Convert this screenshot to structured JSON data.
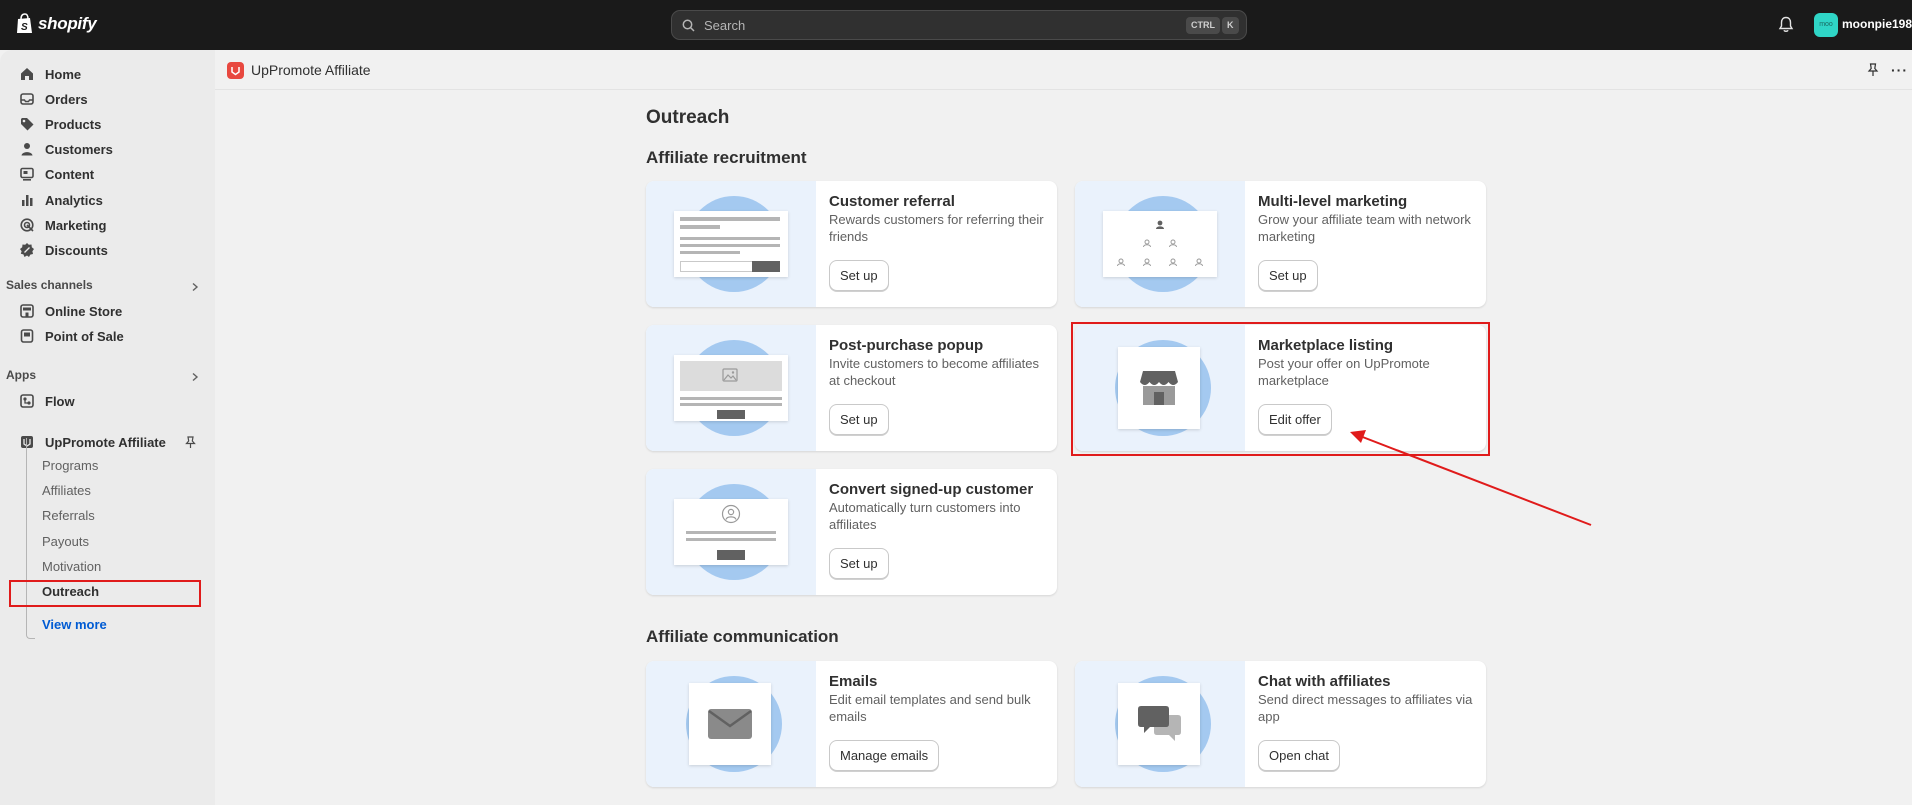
{
  "topbar": {
    "brand": "shopify",
    "search_placeholder": "Search",
    "kbd_ctrl": "CTRL",
    "kbd_k": "K",
    "avatar_initials": "moo",
    "username": "moonpie198"
  },
  "sidebar": {
    "main_items": [
      {
        "label": "Home",
        "icon": "home-icon"
      },
      {
        "label": "Orders",
        "icon": "inbox-icon"
      },
      {
        "label": "Products",
        "icon": "tag-icon"
      },
      {
        "label": "Customers",
        "icon": "person-icon"
      },
      {
        "label": "Content",
        "icon": "content-icon"
      },
      {
        "label": "Analytics",
        "icon": "bar-chart-icon"
      },
      {
        "label": "Marketing",
        "icon": "target-icon"
      },
      {
        "label": "Discounts",
        "icon": "discount-icon"
      }
    ],
    "sales_channels_label": "Sales channels",
    "sales_channels": [
      {
        "label": "Online Store",
        "icon": "store-icon"
      },
      {
        "label": "Point of Sale",
        "icon": "pos-icon"
      }
    ],
    "apps_label": "Apps",
    "apps": [
      {
        "label": "Flow",
        "icon": "flow-icon"
      },
      {
        "label": "UpPromote Affiliate",
        "icon": "app-icon"
      }
    ],
    "app_sub_items": [
      "Programs",
      "Affiliates",
      "Referrals",
      "Payouts",
      "Motivation",
      "Outreach"
    ],
    "view_more": "View more"
  },
  "app_header": {
    "title": "UpPromote Affiliate"
  },
  "main": {
    "page_title": "Outreach",
    "recruitment_title": "Affiliate recruitment",
    "communication_title": "Affiliate communication",
    "cards": [
      {
        "title": "Customer referral",
        "desc": "Rewards customers for referring their friends",
        "button": "Set up"
      },
      {
        "title": "Multi-level marketing",
        "desc": "Grow your affiliate team with network marketing",
        "button": "Set up"
      },
      {
        "title": "Post-purchase popup",
        "desc": "Invite customers to become affiliates at checkout",
        "button": "Set up"
      },
      {
        "title": "Marketplace listing",
        "desc": "Post your offer on UpPromote marketplace",
        "button": "Edit offer"
      },
      {
        "title": "Convert signed-up customer",
        "desc": "Automatically turn customers into affiliates",
        "button": "Set up"
      },
      {
        "title": "Emails",
        "desc": "Edit email templates and send bulk emails",
        "button": "Manage emails"
      },
      {
        "title": "Chat with affiliates",
        "desc": "Send direct messages to affiliates via app",
        "button": "Open chat"
      }
    ]
  },
  "colors": {
    "topbar_bg": "#1a1a1a",
    "highlight": "#e01b1b",
    "illustration_circle": "#a4c9f0",
    "link": "#005bd3"
  }
}
